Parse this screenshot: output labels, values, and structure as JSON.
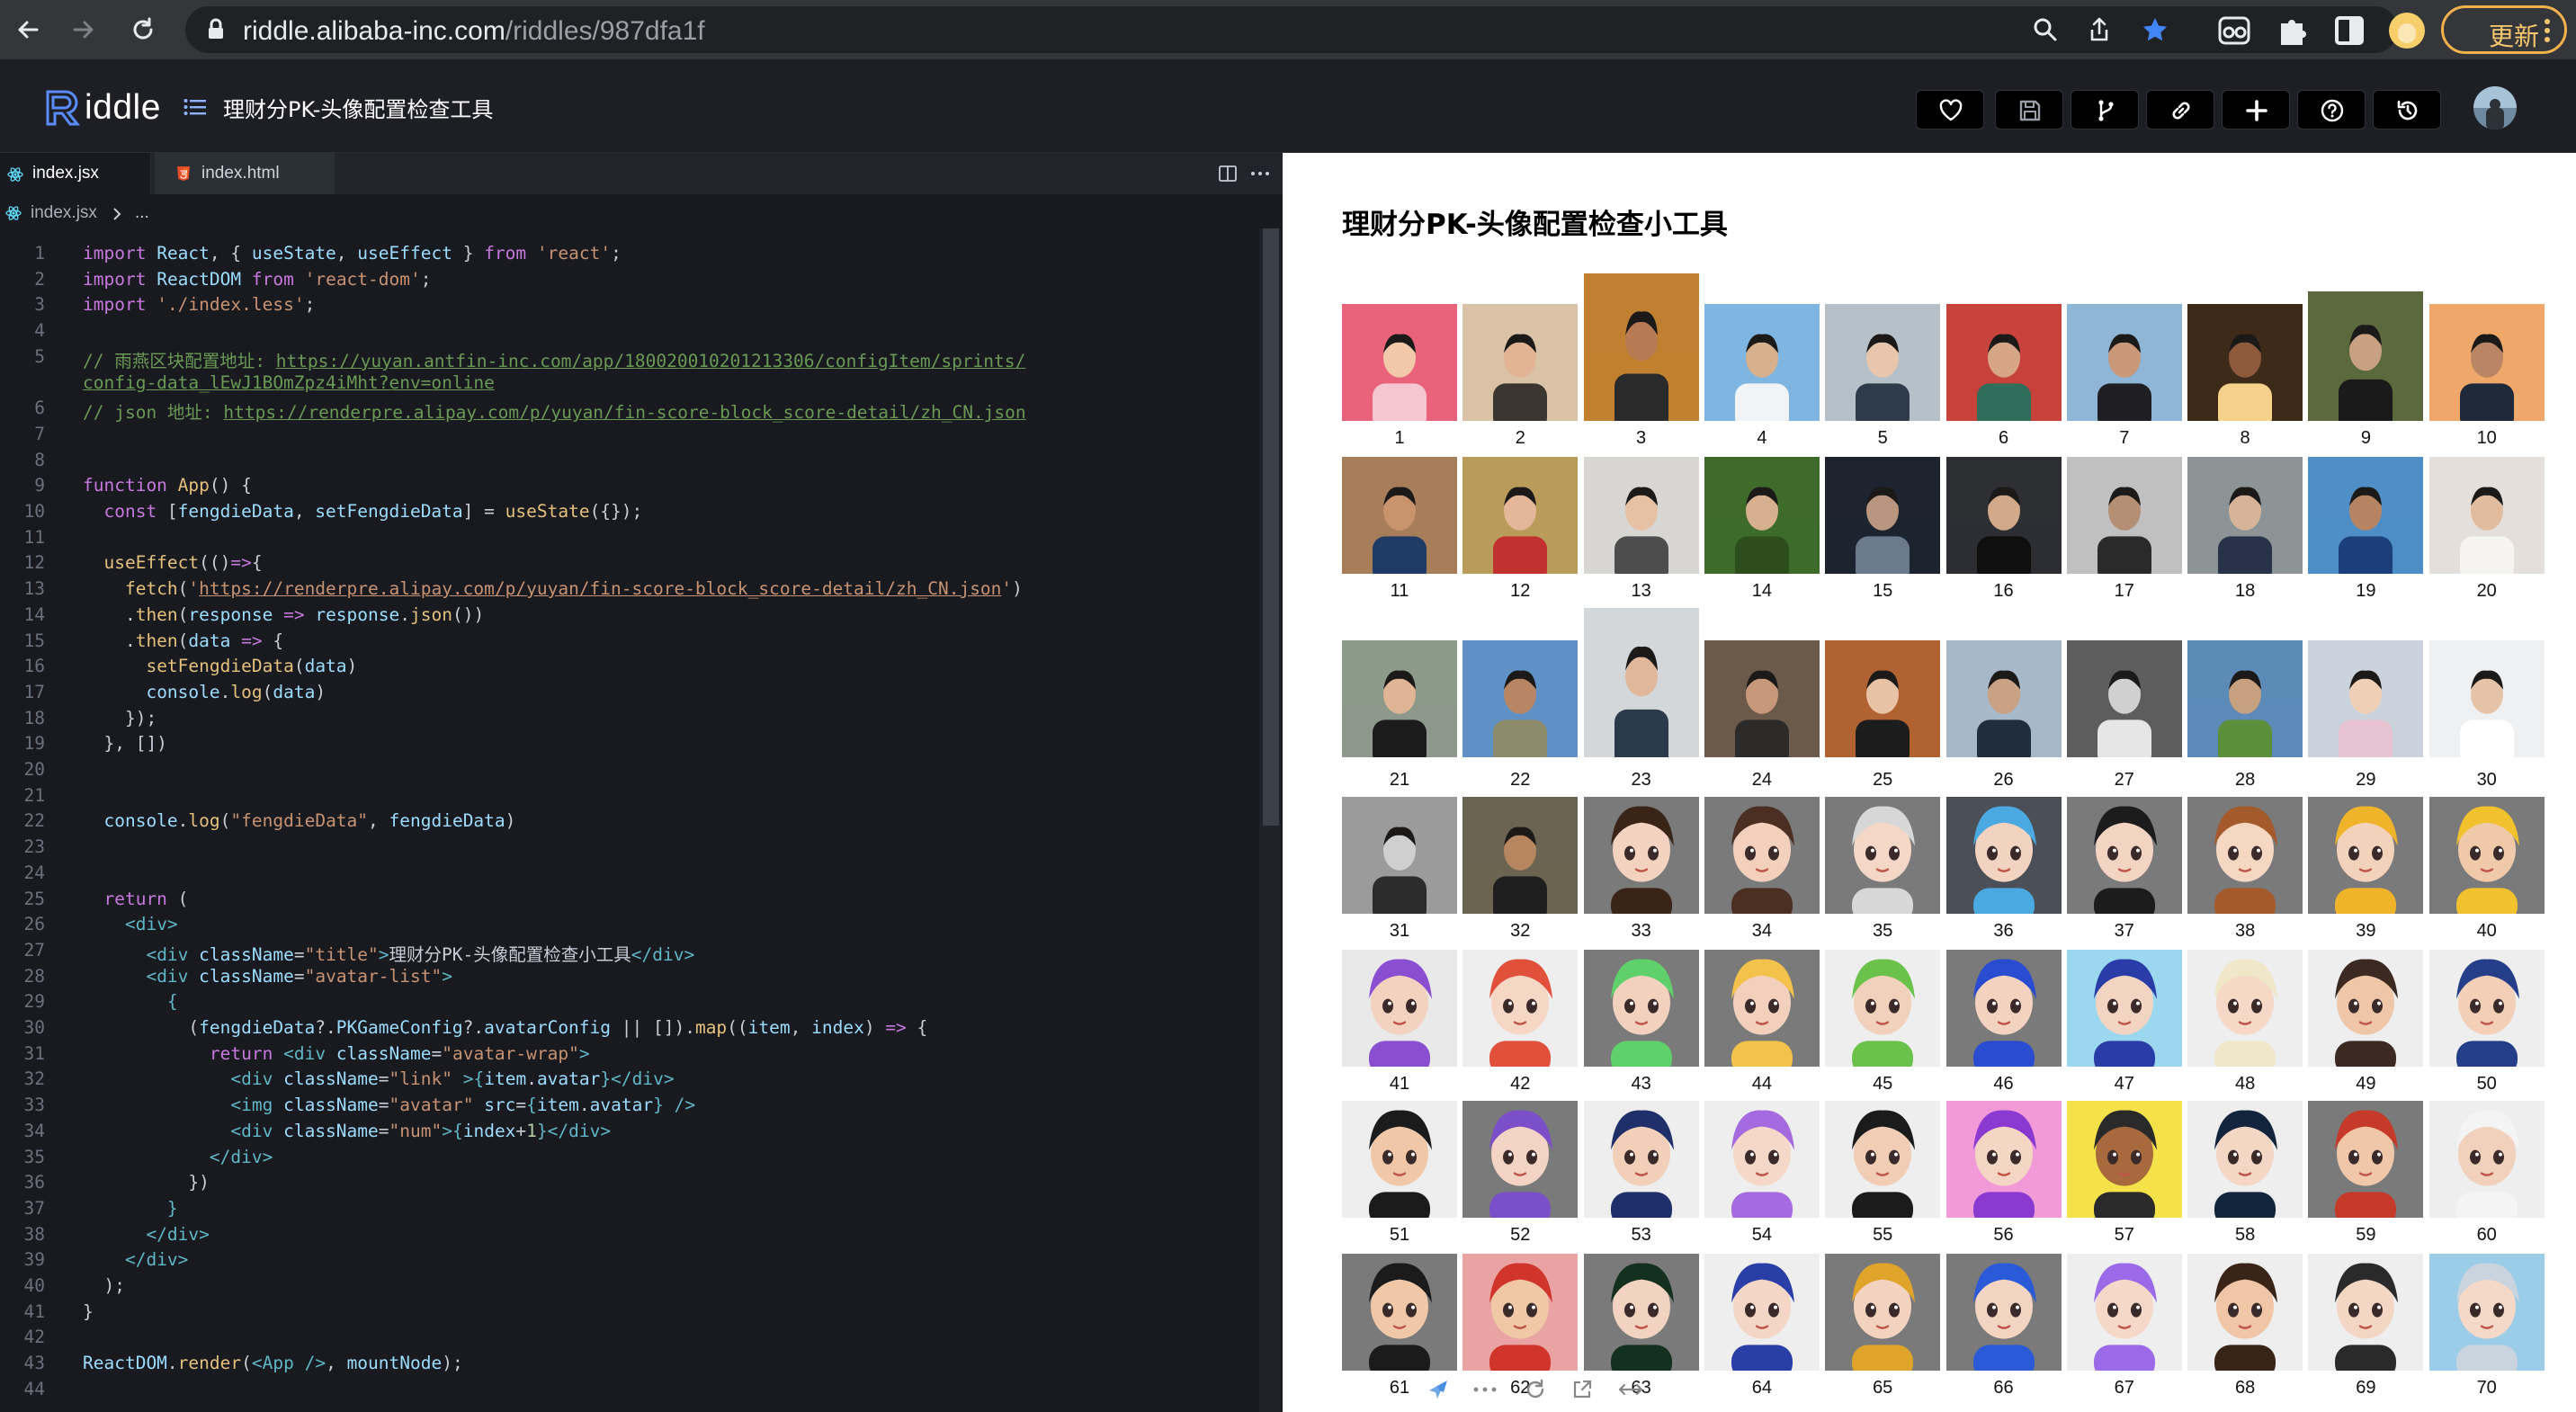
{
  "browser": {
    "url_host": "riddle.alibaba-inc.com",
    "url_path": "/riddles/987dfa1f",
    "update_label": "更新"
  },
  "app": {
    "logo_text": "iddle",
    "project_title": "理财分PK-头像配置检查工具",
    "toolbar_icons": [
      "heart-icon",
      "save-icon",
      "fork-icon",
      "link-icon",
      "plus-icon",
      "help-icon",
      "history-icon"
    ]
  },
  "editor": {
    "tabs": [
      {
        "label": "index.jsx",
        "active": true,
        "icon": "react-icon"
      },
      {
        "label": "index.html",
        "active": false,
        "icon": "html5-icon"
      }
    ],
    "breadcrumb": {
      "file": "index.jsx",
      "rest": "..."
    },
    "lines": [
      {
        "n": "1",
        "html": "<span class='kw'>import</span> <span class='var'>React</span>, { <span class='var'>useState</span>, <span class='var'>useEffect</span> } <span class='kw'>from</span> <span class='str'>'react'</span>;"
      },
      {
        "n": "2",
        "html": "<span class='kw'>import</span> <span class='var'>ReactDOM</span> <span class='kw'>from</span> <span class='str'>'react-dom'</span>;"
      },
      {
        "n": "3",
        "html": "<span class='kw'>import</span> <span class='str'>'./index.less'</span>;"
      },
      {
        "n": "4",
        "html": ""
      },
      {
        "n": "5",
        "html": "<span class='cmt'>// 雨燕区块配置地址: </span><span class='url-u'>https://yuyan.antfin-inc.com/app/180020010201213306/configItem/sprints/</span>"
      },
      {
        "n": "",
        "html": "<span class='url-u'>config-data_lEwJ1BOmZpz4iMht?env=online</span>"
      },
      {
        "n": "6",
        "html": "<span class='cmt'>// json 地址: </span><span class='url-u'>https://renderpre.alipay.com/p/yuyan/fin-score-block_score-detail/zh_CN.json</span>"
      },
      {
        "n": "7",
        "html": ""
      },
      {
        "n": "8",
        "html": ""
      },
      {
        "n": "9",
        "html": "<span class='kw'>function</span> <span class='fn'>App</span>() {"
      },
      {
        "n": "10",
        "html": "  <span class='kw'>const</span> [<span class='var'>fengdieData</span>, <span class='var'>setFengdieData</span>] = <span class='fn'>useState</span>({});"
      },
      {
        "n": "11",
        "html": ""
      },
      {
        "n": "12",
        "html": "  <span class='fn'>useEffect</span>(()<span class='kw'>=&gt;</span>{"
      },
      {
        "n": "13",
        "html": "    <span class='fn'>fetch</span>(<span class='str'>'</span><span class='url-s'>https://renderpre.alipay.com/p/yuyan/fin-score-block_score-detail/zh_CN.json</span><span class='str'>'</span>)"
      },
      {
        "n": "14",
        "html": "    .<span class='fn'>then</span>(<span class='var'>response</span> <span class='kw'>=&gt;</span> <span class='var'>response</span>.<span class='fn'>json</span>())"
      },
      {
        "n": "15",
        "html": "    .<span class='fn'>then</span>(<span class='var'>data</span> <span class='kw'>=&gt;</span> {"
      },
      {
        "n": "16",
        "html": "      <span class='fn'>setFengdieData</span>(<span class='var'>data</span>)"
      },
      {
        "n": "17",
        "html": "      <span class='var'>console</span>.<span class='fn'>log</span>(<span class='var'>data</span>)"
      },
      {
        "n": "18",
        "html": "    });"
      },
      {
        "n": "19",
        "html": "  }, [])"
      },
      {
        "n": "20",
        "html": ""
      },
      {
        "n": "21",
        "html": ""
      },
      {
        "n": "22",
        "html": "  <span class='var'>console</span>.<span class='fn'>log</span>(<span class='str'>\"fengdieData\"</span>, <span class='var'>fengdieData</span>)"
      },
      {
        "n": "23",
        "html": ""
      },
      {
        "n": "24",
        "html": ""
      },
      {
        "n": "25",
        "html": "  <span class='kw'>return</span> ("
      },
      {
        "n": "26",
        "html": "    <span class='tag'>&lt;div&gt;</span>"
      },
      {
        "n": "27",
        "html": "      <span class='tag'>&lt;div</span> <span class='attr'>className</span>=<span class='str'>\"title\"</span><span class='tag'>&gt;</span>理财分PK-头像配置检查小工具<span class='tag'>&lt;/div&gt;</span>"
      },
      {
        "n": "28",
        "html": "      <span class='tag'>&lt;div</span> <span class='attr'>className</span>=<span class='str'>\"avatar-list\"</span><span class='tag'>&gt;</span>"
      },
      {
        "n": "29",
        "html": "        <span class='tag'>{</span>"
      },
      {
        "n": "30",
        "html": "          (<span class='var'>fengdieData</span>?.<span class='var'>PKGameConfig</span>?.<span class='var'>avatarConfig</span> || []).<span class='fn'>map</span>((<span class='var'>item</span>, <span class='var'>index</span>) <span class='kw'>=&gt;</span> {"
      },
      {
        "n": "31",
        "html": "            <span class='kw'>return</span> <span class='tag'>&lt;div</span> <span class='attr'>className</span>=<span class='str'>\"avatar-wrap\"</span><span class='tag'>&gt;</span>"
      },
      {
        "n": "32",
        "html": "              <span class='tag'>&lt;div</span> <span class='attr'>className</span>=<span class='str'>\"link\"</span> <span class='tag'>&gt;</span><span class='tag'>{</span><span class='var'>item</span>.<span class='var'>avatar</span><span class='tag'>}</span><span class='tag'>&lt;/div&gt;</span>"
      },
      {
        "n": "33",
        "html": "              <span class='tag'>&lt;img</span> <span class='attr'>className</span>=<span class='str'>\"avatar\"</span> <span class='attr'>src</span>=<span class='tag'>{</span><span class='var'>item</span>.<span class='var'>avatar</span><span class='tag'>}</span> <span class='tag'>/&gt;</span>"
      },
      {
        "n": "34",
        "html": "              <span class='tag'>&lt;div</span> <span class='attr'>className</span>=<span class='str'>\"num\"</span><span class='tag'>&gt;</span><span class='tag'>{</span><span class='var'>index</span>+<span class='num'>1</span><span class='tag'>}</span><span class='tag'>&lt;/div&gt;</span>"
      },
      {
        "n": "35",
        "html": "            <span class='tag'>&lt;/div&gt;</span>"
      },
      {
        "n": "36",
        "html": "          })"
      },
      {
        "n": "37",
        "html": "        <span class='tag'>}</span>"
      },
      {
        "n": "38",
        "html": "      <span class='tag'>&lt;/div&gt;</span>"
      },
      {
        "n": "39",
        "html": "    <span class='tag'>&lt;/div&gt;</span>"
      },
      {
        "n": "40",
        "html": "  );"
      },
      {
        "n": "41",
        "html": "}"
      },
      {
        "n": "42",
        "html": ""
      },
      {
        "n": "43",
        "html": "<span class='var'>ReactDOM</span>.<span class='fn'>render</span>(<span class='tag'>&lt;App</span> <span class='tag'>/&gt;</span>, <span class='var'>mountNode</span>);"
      },
      {
        "n": "44",
        "html": ""
      }
    ]
  },
  "preview": {
    "title": "理财分PK-头像配置检查小工具",
    "avatars": [
      {
        "num": "1",
        "kind": "photo",
        "bg": "#e8627a",
        "fg": "#f5c6cf",
        "skin": "#f1c9a8"
      },
      {
        "num": "2",
        "kind": "photo",
        "bg": "#d9c2a6",
        "fg": "#3b3530",
        "skin": "#e2b493"
      },
      {
        "num": "3",
        "kind": "photo",
        "bg": "#c1802f",
        "fg": "#2a2a2a",
        "skin": "#b77b54"
      },
      {
        "num": "4",
        "kind": "photo",
        "bg": "#7fb5e1",
        "fg": "#f1f4f7",
        "skin": "#d7b08e"
      },
      {
        "num": "5",
        "kind": "photo",
        "bg": "#b6c0c9",
        "fg": "#2d3b4a",
        "skin": "#e7c6ad"
      },
      {
        "num": "6",
        "kind": "photo",
        "bg": "#c8433c",
        "fg": "#2f6e5a",
        "skin": "#d6a585"
      },
      {
        "num": "7",
        "kind": "photo",
        "bg": "#8fb6d7",
        "fg": "#1f1f23",
        "skin": "#c99878"
      },
      {
        "num": "8",
        "kind": "photo",
        "bg": "#3e2a18",
        "fg": "#f6d18b",
        "skin": "#8d5b3b"
      },
      {
        "num": "9",
        "kind": "photo",
        "bg": "#5a6a3c",
        "fg": "#1a1a1a",
        "skin": "#c8a183"
      },
      {
        "num": "10",
        "kind": "photo",
        "bg": "#f0a76a",
        "fg": "#1e2a3a",
        "skin": "#b98565"
      },
      {
        "num": "11",
        "kind": "photo",
        "bg": "#a77d5a",
        "fg": "#1f3c67",
        "skin": "#c9946d"
      },
      {
        "num": "12",
        "kind": "photo",
        "bg": "#b99b5a",
        "fg": "#c1312f",
        "skin": "#e3b797"
      },
      {
        "num": "13",
        "kind": "photo",
        "bg": "#d8d6d3",
        "fg": "#4d4d4d",
        "skin": "#e6c1a4"
      },
      {
        "num": "14",
        "kind": "photo",
        "bg": "#3e6b2a",
        "fg": "#2d4d1c",
        "skin": "#d6b08e"
      },
      {
        "num": "15",
        "kind": "photo",
        "bg": "#1d2430",
        "fg": "#6b7a8c",
        "skin": "#b99680"
      },
      {
        "num": "16",
        "kind": "photo",
        "bg": "#2d2f33",
        "fg": "#0f0f10",
        "skin": "#d1a989"
      },
      {
        "num": "17",
        "kind": "photo",
        "bg": "#bfc0bf",
        "fg": "#2a2a2a",
        "skin": "#b48f73"
      },
      {
        "num": "18",
        "kind": "photo",
        "bg": "#8d9496",
        "fg": "#28334a",
        "skin": "#d6b49a"
      },
      {
        "num": "19",
        "kind": "photo",
        "bg": "#4f8ec6",
        "fg": "#1b3f7a",
        "skin": "#b68462"
      },
      {
        "num": "20",
        "kind": "photo",
        "bg": "#e4dfda",
        "fg": "#f6f4f1",
        "skin": "#e1bc9f"
      },
      {
        "num": "21",
        "kind": "photo",
        "bg": "#8c9a8a",
        "fg": "#1b1b1b",
        "skin": "#e0b595"
      },
      {
        "num": "22",
        "kind": "photo",
        "bg": "#5f91c7",
        "fg": "#8d8a6a",
        "skin": "#b98665"
      },
      {
        "num": "23",
        "kind": "photo",
        "bg": "#d4d7da",
        "fg": "#2b3b4c",
        "skin": "#e0b79a"
      },
      {
        "num": "24",
        "kind": "photo",
        "bg": "#6b5a49",
        "fg": "#2c2b2a",
        "skin": "#c7987a"
      },
      {
        "num": "25",
        "kind": "photo",
        "bg": "#b06231",
        "fg": "#1c1c1c",
        "skin": "#e8c2a5"
      },
      {
        "num": "26",
        "kind": "photo",
        "bg": "#a7b8c9",
        "fg": "#1f2d3d",
        "skin": "#c9a184"
      },
      {
        "num": "27",
        "kind": "photo",
        "bg": "#5d5d5d",
        "fg": "#e6e6e6",
        "skin": "#d0d0d0"
      },
      {
        "num": "28",
        "kind": "photo",
        "bg": "#5d8bb8",
        "fg": "#5b8f3a",
        "skin": "#c7a080"
      },
      {
        "num": "29",
        "kind": "photo",
        "bg": "#cad3dc",
        "fg": "#e7c2d0",
        "skin": "#efcfb5"
      },
      {
        "num": "30",
        "kind": "photo",
        "bg": "#eef0f1",
        "fg": "#ffffff",
        "skin": "#e5c3a7"
      },
      {
        "num": "31",
        "kind": "photo",
        "bg": "#9b9b9b",
        "fg": "#2c2c2c",
        "skin": "#cfcfcf"
      },
      {
        "num": "32",
        "kind": "photo",
        "bg": "#6b6452",
        "fg": "#1f1f1f",
        "skin": "#b5865f"
      },
      {
        "num": "33",
        "kind": "cartoon",
        "bg": "#7a7a7a",
        "fg": "#3a2418",
        "skin": "#f3d2bf"
      },
      {
        "num": "34",
        "kind": "cartoon",
        "bg": "#7a7a7a",
        "fg": "#4a2f22",
        "skin": "#f2d0bc"
      },
      {
        "num": "35",
        "kind": "cartoon",
        "bg": "#7a7a7a",
        "fg": "#d7d7d7",
        "skin": "#f4d7c6"
      },
      {
        "num": "36",
        "kind": "cartoon",
        "bg": "#4b4f57",
        "fg": "#4aa9e0",
        "skin": "#f2d2c0"
      },
      {
        "num": "37",
        "kind": "cartoon",
        "bg": "#7a7a7a",
        "fg": "#1c1c1c",
        "skin": "#f3d3c2"
      },
      {
        "num": "38",
        "kind": "cartoon",
        "bg": "#7a7a7a",
        "fg": "#a45a2a",
        "skin": "#f5d7c2"
      },
      {
        "num": "39",
        "kind": "cartoon",
        "bg": "#7a7a7a",
        "fg": "#f0b42a",
        "skin": "#f3d2bc"
      },
      {
        "num": "40",
        "kind": "cartoon",
        "bg": "#7a7a7a",
        "fg": "#f2c12e",
        "skin": "#f0c9a9"
      },
      {
        "num": "41",
        "kind": "cartoon",
        "bg": "#e9e9e9",
        "fg": "#8a4fd0",
        "skin": "#f3d3bf"
      },
      {
        "num": "42",
        "kind": "cartoon",
        "bg": "#eeeeee",
        "fg": "#e0503a",
        "skin": "#f6d6c5"
      },
      {
        "num": "43",
        "kind": "cartoon",
        "bg": "#7a7a7a",
        "fg": "#5fd06a",
        "skin": "#f2d2bf"
      },
      {
        "num": "44",
        "kind": "cartoon",
        "bg": "#7a7a7a",
        "fg": "#f2c24a",
        "skin": "#f3d0bc"
      },
      {
        "num": "45",
        "kind": "cartoon",
        "bg": "#eeeeee",
        "fg": "#6ac24a",
        "skin": "#f2d1bc"
      },
      {
        "num": "46",
        "kind": "cartoon",
        "bg": "#7a7a7a",
        "fg": "#2a4cd0",
        "skin": "#f3d3c0"
      },
      {
        "num": "47",
        "kind": "cartoon",
        "bg": "#9bd8ef",
        "fg": "#2a3ca8",
        "skin": "#f3d4c2"
      },
      {
        "num": "48",
        "kind": "cartoon",
        "bg": "#eeeeee",
        "fg": "#f0e6c8",
        "skin": "#f5d8c6"
      },
      {
        "num": "49",
        "kind": "cartoon",
        "bg": "#eeeeee",
        "fg": "#3c2a22",
        "skin": "#f0c6a8"
      },
      {
        "num": "50",
        "kind": "cartoon",
        "bg": "#eeeeee",
        "fg": "#243e8a",
        "skin": "#f2cfb6"
      },
      {
        "num": "51",
        "kind": "cartoon",
        "bg": "#eeeeee",
        "fg": "#1b1b1b",
        "skin": "#f0c7a7"
      },
      {
        "num": "52",
        "kind": "cartoon",
        "bg": "#7a7a7a",
        "fg": "#7a4fc8",
        "skin": "#f3d4c4"
      },
      {
        "num": "53",
        "kind": "cartoon",
        "bg": "#eeeeee",
        "fg": "#1e2f6a",
        "skin": "#f2cfb8"
      },
      {
        "num": "54",
        "kind": "cartoon",
        "bg": "#eeeeee",
        "fg": "#a66ae0",
        "skin": "#f5d8c8"
      },
      {
        "num": "55",
        "kind": "cartoon",
        "bg": "#eeeeee",
        "fg": "#1b1b1b",
        "skin": "#f0cdb4"
      },
      {
        "num": "56",
        "kind": "cartoon",
        "bg": "#f29ad8",
        "fg": "#8a3ad0",
        "skin": "#f5d6c4"
      },
      {
        "num": "57",
        "kind": "cartoon",
        "bg": "#f5e24a",
        "fg": "#2a2a2a",
        "skin": "#a86a3c"
      },
      {
        "num": "58",
        "kind": "cartoon",
        "bg": "#eeeeee",
        "fg": "#13243d",
        "skin": "#f4d6c4"
      },
      {
        "num": "59",
        "kind": "cartoon",
        "bg": "#7a7a7a",
        "fg": "#c63a2a",
        "skin": "#f0c8a9"
      },
      {
        "num": "60",
        "kind": "cartoon",
        "bg": "#eeeeee",
        "fg": "#f4f4f4",
        "skin": "#f2d1bc"
      },
      {
        "num": "61",
        "kind": "cartoon",
        "bg": "#7a7a7a",
        "fg": "#1b1b1b",
        "skin": "#f0c8a8"
      },
      {
        "num": "62",
        "kind": "cartoon",
        "bg": "#e9a3a3",
        "fg": "#d0342a",
        "skin": "#f0c8a6"
      },
      {
        "num": "63",
        "kind": "cartoon",
        "bg": "#7a7a7a",
        "fg": "#14301f",
        "skin": "#f2d2c0"
      },
      {
        "num": "64",
        "kind": "cartoon",
        "bg": "#eeeeee",
        "fg": "#2a3ea8",
        "skin": "#f4d6c6"
      },
      {
        "num": "65",
        "kind": "cartoon",
        "bg": "#7a7a7a",
        "fg": "#e0a42a",
        "skin": "#f3d3c0"
      },
      {
        "num": "66",
        "kind": "cartoon",
        "bg": "#7a7a7a",
        "fg": "#2a5ad8",
        "skin": "#f3d4c2"
      },
      {
        "num": "67",
        "kind": "cartoon",
        "bg": "#eeeeee",
        "fg": "#9a6ae8",
        "skin": "#f5d8c8"
      },
      {
        "num": "68",
        "kind": "cartoon",
        "bg": "#eeeeee",
        "fg": "#3a2418",
        "skin": "#f0c6a6"
      },
      {
        "num": "69",
        "kind": "cartoon",
        "bg": "#eeeeee",
        "fg": "#2a2a2a",
        "skin": "#f4d6c4"
      },
      {
        "num": "70",
        "kind": "cartoon",
        "bg": "#9bcde8",
        "fg": "#c9d4de",
        "skin": "#f4d8c8"
      }
    ]
  },
  "colors": {
    "chrome_bg": "#35363a",
    "header_bg": "#1e1f25",
    "editor_bg": "#181a1f",
    "update_accent": "#f2b24b",
    "star_blue": "#4285f4"
  }
}
